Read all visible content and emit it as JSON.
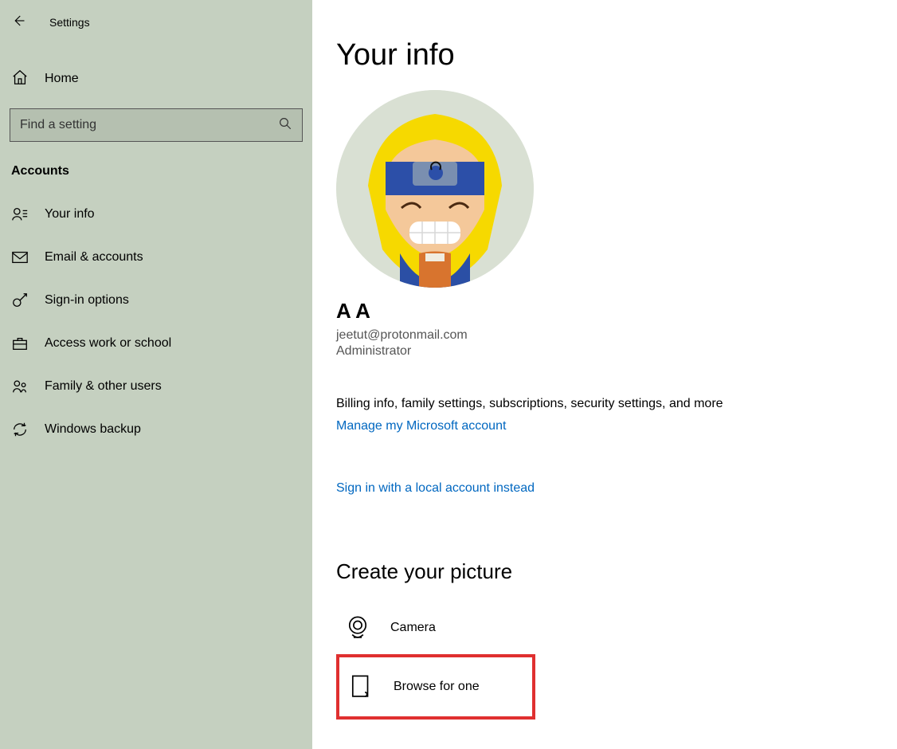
{
  "header": {
    "back_icon": "back",
    "title": "Settings"
  },
  "sidebar": {
    "home_label": "Home",
    "search_placeholder": "Find a setting",
    "section": "Accounts",
    "items": [
      {
        "icon": "person-lines",
        "label": "Your info"
      },
      {
        "icon": "mail",
        "label": "Email & accounts"
      },
      {
        "icon": "key",
        "label": "Sign-in options"
      },
      {
        "icon": "briefcase",
        "label": "Access work or school"
      },
      {
        "icon": "family",
        "label": "Family & other users"
      },
      {
        "icon": "sync",
        "label": "Windows backup"
      }
    ]
  },
  "main": {
    "title": "Your info",
    "username": "A A",
    "email": "jeetut@protonmail.com",
    "role": "Administrator",
    "billing_line": "Billing info, family settings, subscriptions, security settings, and more",
    "manage_link": "Manage my Microsoft account",
    "local_link": "Sign in with a local account instead",
    "create_heading": "Create your picture",
    "camera_label": "Camera",
    "browse_label": "Browse for one"
  }
}
